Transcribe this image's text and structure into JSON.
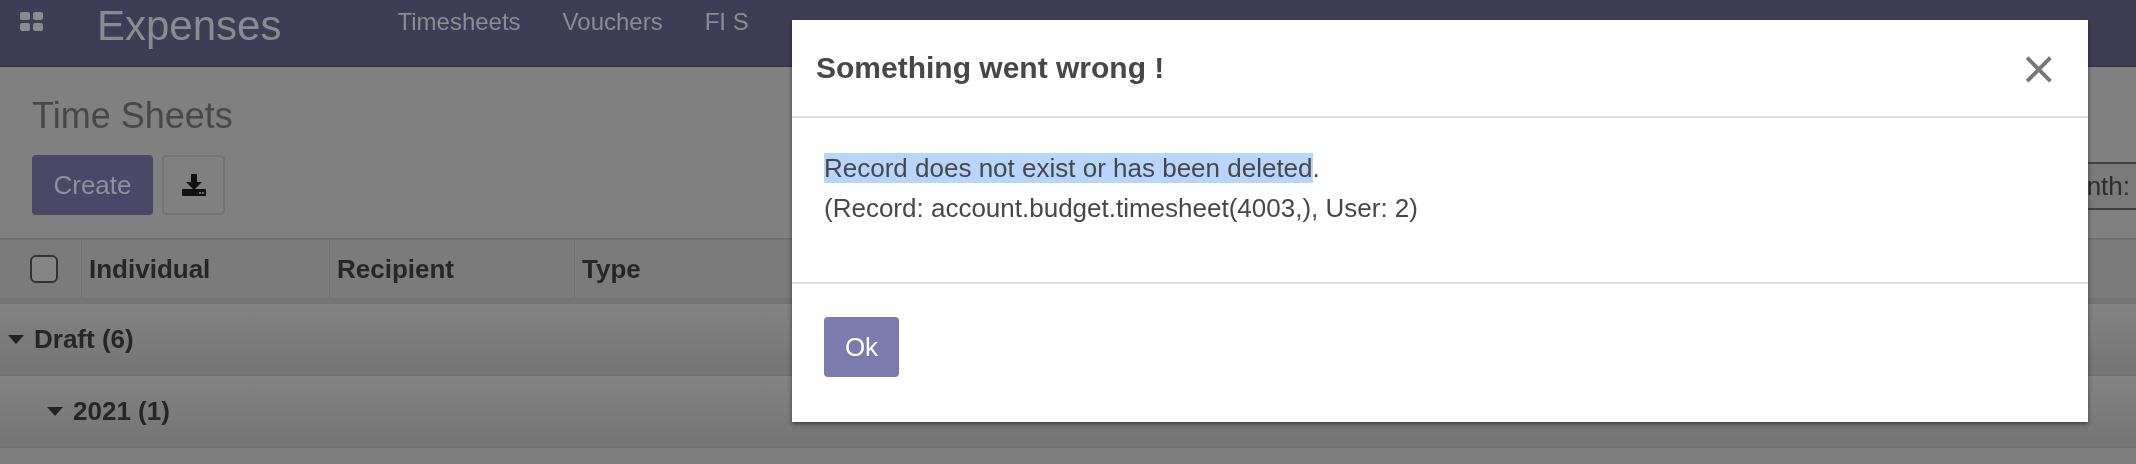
{
  "navbar": {
    "app_name": "Expenses",
    "menu": [
      "Timesheets",
      "Vouchers",
      "FI S"
    ]
  },
  "page": {
    "title": "Time Sheets",
    "create_button": "Create",
    "side_field_label": "nth:"
  },
  "table": {
    "select_all_checked": false,
    "columns": [
      "Individual",
      "Recipient",
      "Type"
    ],
    "groups": [
      {
        "label": "Draft (6)",
        "expanded": true,
        "children": [
          {
            "label": "2021 (1)",
            "expanded": true
          }
        ]
      }
    ]
  },
  "dialog": {
    "title": "Something went wrong !",
    "close": "×",
    "message": "Record does not exist or has been deleted.",
    "message_highlighted": true,
    "detail": "(Record: account.budget.timesheet(4003,), User: 2)",
    "ok_button": "Ok"
  }
}
